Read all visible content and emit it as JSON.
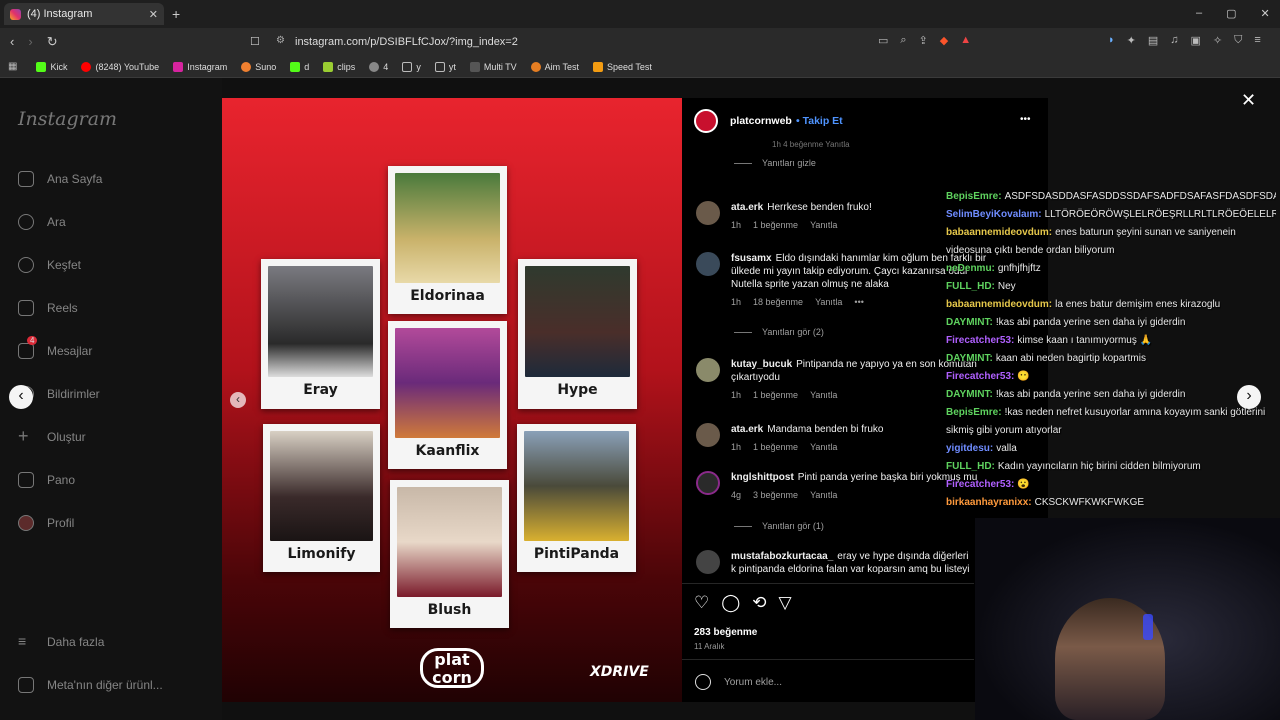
{
  "browser": {
    "tab_title": "(4) Instagram",
    "new_tab": "+",
    "url": "instagram.com/p/DSIBFLfCJox/?img_index=2",
    "bookmarks": [
      "Kick",
      "(8248) YouTube",
      "Instagram",
      "Suno",
      "d",
      "clips",
      "4",
      "y",
      "yt",
      "Multi TV",
      "Aim Test",
      "Speed Test"
    ],
    "window_controls": [
      "–",
      "▢",
      "✕"
    ]
  },
  "sidebar": {
    "logo": "Instagram",
    "items": [
      "Ana Sayfa",
      "Ara",
      "Keşfet",
      "Reels",
      "Mesajlar",
      "Bildirimler",
      "Oluştur",
      "Pano",
      "Profil"
    ],
    "messages_badge": "4",
    "more": "Daha fazla",
    "meta": "Meta'nın diğer ürünl..."
  },
  "post": {
    "cards": [
      "Eldorinaa",
      "Eray",
      "Hype",
      "Kaanflix",
      "Limonify",
      "PintiPanda",
      "Blush"
    ],
    "logo_left": "plat corn",
    "logo_right": "XDRIVE"
  },
  "comments_panel": {
    "author": "platcornweb",
    "follow": "• Takip Et",
    "more": "•••",
    "top_meta": "1h   4 beğenme   Yanıtla",
    "hide_replies": "Yanıtları gizle",
    "comments": [
      {
        "user": "ata.erk",
        "text": "Herrkese benden fruko!",
        "time": "1h",
        "likes": "1 beğenme",
        "reply": "Yanıtla"
      },
      {
        "user": "fsusamx",
        "text": "Eldo dışındaki hanımlar kim oğlum ben farklı bir ülkede mi yayın takip ediyorum. Çaycı kazanırsa ödül Nutella sprite yazan olmuş ne alaka",
        "time": "1h",
        "likes": "18 beğenme",
        "reply": "Yanıtla",
        "dots": "•••"
      },
      {
        "user": "kutay_bucuk",
        "text": "Pintipanda ne yapıyo ya en son komutan çıkartıyodu",
        "time": "1h",
        "likes": "1 beğenme",
        "reply": "Yanıtla"
      },
      {
        "user": "ata.erk",
        "text": "Mandama benden bi fruko",
        "time": "1h",
        "likes": "1 beğenme",
        "reply": "Yanıtla"
      },
      {
        "user": "knglshittpost",
        "text": "Pinti panda yerine başka biri yokmuş mu",
        "time": "4g",
        "likes": "3 beğenme",
        "reply": "Yanıtla"
      },
      {
        "user": "mustafabozkurtacaa_",
        "text": "eray ve hype dışında diğerleri k pintipanda eldorina falan var koparsın amq bu listeyi b",
        "time": "",
        "likes": "",
        "reply": ""
      }
    ],
    "view_replies_2": "Yanıtları gör (2)",
    "view_replies_1": "Yanıtları gör (1)",
    "likes_count": "283 beğenme",
    "date": "11 Aralık",
    "comment_placeholder": "Yorum ekle..."
  },
  "chat": [
    {
      "user": "BepisEmre:",
      "text": "ASDFSDASDDASFASDDSSDAFSADFDSAFASFDASDFSDA",
      "color": "#5fd35f"
    },
    {
      "user": "SelimBeyiKovalaım:",
      "text": "LLTÖRÖEÖRÖWŞLELRÖEŞRLLRLTLRÖEÖELELRLRL",
      "color": "#6f8cff"
    },
    {
      "user": "babaannemideovdum:",
      "text": "enes baturun şeyini sunan ve saniyenein videosuna çıktı bende ordan biliyorum",
      "color": "#e6c84b"
    },
    {
      "user": "neDenmu:",
      "text": "gnfhjfhjftz",
      "color": "#5fd35f"
    },
    {
      "user": "FULL_HD:",
      "text": "Ney",
      "color": "#5fd35f"
    },
    {
      "user": "babaannemideovdum:",
      "text": "la enes batur demişim enes kirazoglu",
      "color": "#e6c84b"
    },
    {
      "user": "DAYMINT:",
      "text": "!kas abi panda yerine sen daha iyi giderdin",
      "color": "#5fd35f"
    },
    {
      "user": "Firecatcher53:",
      "text": "kimse kaan ı tanımıyormuş 🙏",
      "color": "#b060ff"
    },
    {
      "user": "DAYMINT:",
      "text": "kaan abi neden bagirtip kopartmis",
      "color": "#5fd35f"
    },
    {
      "user": "Firecatcher53:",
      "text": "😶",
      "color": "#b060ff"
    },
    {
      "user": "DAYMINT:",
      "text": "!kas abi panda yerine sen daha iyi giderdin",
      "color": "#5fd35f"
    },
    {
      "user": "BepisEmre:",
      "text": "!kas neden nefret kusuyorlar amına koyayım sanki götlerini sikmiş gibi yorum atıyorlar",
      "color": "#5fd35f"
    },
    {
      "user": "yigitdesu:",
      "text": "valla",
      "color": "#6f8cff"
    },
    {
      "user": "FULL_HD:",
      "text": "Kadın yayıncıların hiç birini cidden bilmiyorum",
      "color": "#5fd35f"
    },
    {
      "user": "Firecatcher53:",
      "text": "😮",
      "color": "#b060ff"
    },
    {
      "user": "birkaanhayranixx:",
      "text": "CKSCKWFKWKFWKGE",
      "color": "#ff9a3c"
    }
  ]
}
